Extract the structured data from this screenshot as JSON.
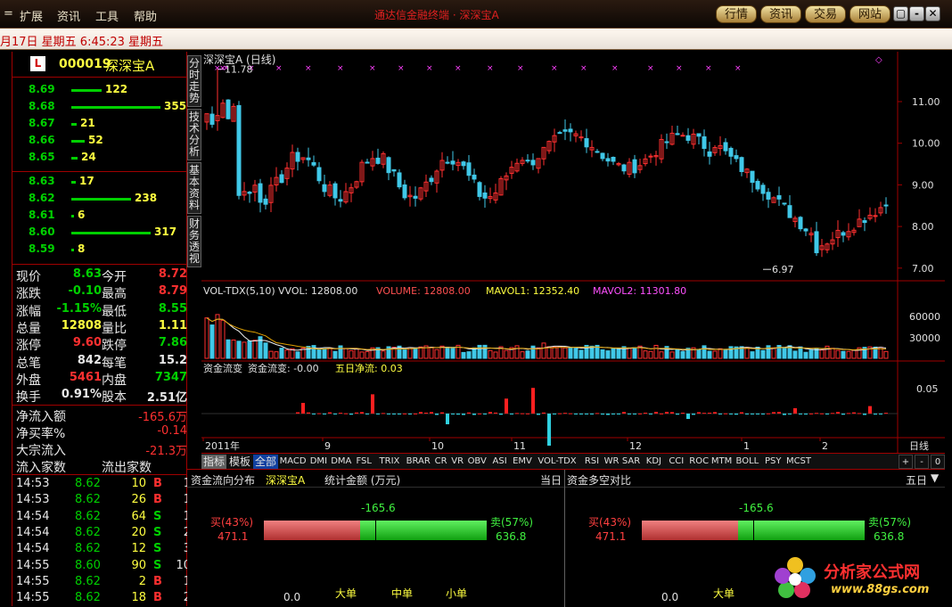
{
  "menu": {
    "items": [
      "扩展",
      "资讯",
      "工具",
      "帮助"
    ],
    "title": "通达信金融终端 · 深深宝A"
  },
  "top_buttons": [
    "行情",
    "资讯",
    "交易",
    "网站"
  ],
  "window_controls": [
    "▢",
    "-",
    "□",
    "✕"
  ],
  "status": {
    "datetime": "月17日  星期五  6:45:23 星期五"
  },
  "stock": {
    "badge": "L",
    "code": "000019",
    "name": "深深宝A"
  },
  "orderbook": {
    "asks": [
      {
        "price": "8.69",
        "vol": "122",
        "len": 0.34
      },
      {
        "price": "8.68",
        "vol": "355",
        "len": 1.0
      },
      {
        "price": "8.67",
        "vol": "21",
        "len": 0.06
      },
      {
        "price": "8.66",
        "vol": "52",
        "len": 0.15
      },
      {
        "price": "8.65",
        "vol": "24",
        "len": 0.07
      }
    ],
    "bids": [
      {
        "price": "8.63",
        "vol": "17",
        "len": 0.05
      },
      {
        "price": "8.62",
        "vol": "238",
        "len": 0.67
      },
      {
        "price": "8.61",
        "vol": "6",
        "len": 0.02
      },
      {
        "price": "8.60",
        "vol": "317",
        "len": 0.89
      },
      {
        "price": "8.59",
        "vol": "8",
        "len": 0.02
      }
    ]
  },
  "quote": [
    {
      "l1": "现价",
      "v1": "8.63",
      "c1": "#00d000",
      "l2": "今开",
      "v2": "8.72",
      "c2": "#ff3030"
    },
    {
      "l1": "涨跌",
      "v1": "-0.10",
      "c1": "#00d000",
      "l2": "最高",
      "v2": "8.79",
      "c2": "#ff3030"
    },
    {
      "l1": "涨幅",
      "v1": "-1.15%",
      "c1": "#00d000",
      "l2": "最低",
      "v2": "8.55",
      "c2": "#00d000"
    },
    {
      "l1": "总量",
      "v1": "12808",
      "c1": "#ffff40",
      "l2": "量比",
      "v2": "1.11",
      "c2": "#ffff40"
    },
    {
      "l1": "涨停",
      "v1": "9.60",
      "c1": "#ff3030",
      "l2": "跌停",
      "v2": "7.86",
      "c2": "#00d000"
    },
    {
      "l1": "总笔",
      "v1": "842",
      "c1": "#e8e8e8",
      "l2": "每笔",
      "v2": "15.2",
      "c2": "#e8e8e8"
    },
    {
      "l1": "外盘",
      "v1": "5461",
      "c1": "#ff3030",
      "l2": "内盘",
      "v2": "7347",
      "c2": "#00d000"
    },
    {
      "l1": "换手",
      "v1": "0.91%",
      "c1": "#e8e8e8",
      "l2": "股本",
      "v2": "2.51亿",
      "c2": "#e8e8e8"
    }
  ],
  "flow": [
    {
      "label": "净流入额",
      "value": "-165.6万",
      "color": "#ff3030"
    },
    {
      "label": "净买率%",
      "value": "-0.14",
      "color": "#ff3030"
    },
    {
      "label": "大宗流入",
      "value": "-21.3万",
      "color": "#ff3030"
    },
    {
      "label": "流入家数",
      "value": "流出家数",
      "color": "#e8e8e8"
    }
  ],
  "ticks": [
    {
      "time": "14:53",
      "price": "8.62",
      "vol": "10",
      "bs": "B",
      "n": "1"
    },
    {
      "time": "14:53",
      "price": "8.62",
      "vol": "26",
      "bs": "B",
      "n": "1"
    },
    {
      "time": "14:54",
      "price": "8.62",
      "vol": "64",
      "bs": "S",
      "n": "1"
    },
    {
      "time": "14:54",
      "price": "8.62",
      "vol": "20",
      "bs": "S",
      "n": "2"
    },
    {
      "time": "14:54",
      "price": "8.62",
      "vol": "12",
      "bs": "S",
      "n": "3"
    },
    {
      "time": "14:55",
      "price": "8.60",
      "vol": "90",
      "bs": "S",
      "n": "10"
    },
    {
      "time": "14:55",
      "price": "8.62",
      "vol": "2",
      "bs": "B",
      "n": "1"
    },
    {
      "time": "14:55",
      "price": "8.62",
      "vol": "18",
      "bs": "B",
      "n": "2"
    }
  ],
  "vtabs": [
    "分时走势",
    "技术分析",
    "基本资料",
    "财务透视"
  ],
  "main_chart": {
    "title": "深深宝A (日线)",
    "high_label": "11.78",
    "low_label": "6.97",
    "y_ticks": [
      "11.00",
      "10.00",
      "9.00",
      "8.00",
      "7.00"
    ]
  },
  "vol_chart": {
    "header": [
      "VOL-TDX(5,10)",
      "VVOL: 12808.00",
      "VOLUME: 12808.00",
      "MAVOL1: 12352.40",
      "MAVOL2: 11301.80"
    ],
    "y_ticks": [
      "60000",
      "30000"
    ]
  },
  "flow_chart": {
    "header": [
      "资金流变",
      "资金流变: -0.00",
      "五日净流: 0.03"
    ],
    "y_ticks": [
      "0.05"
    ]
  },
  "x_labels": [
    "2011年",
    "9",
    "10",
    "11",
    "12",
    "1",
    "2"
  ],
  "x_right_label": "日线",
  "indicator_tabs": [
    "指标",
    "模板",
    "全部",
    "MACD",
    "DMI",
    "DMA",
    "FSL",
    "TRIX",
    "BRAR",
    "CR",
    "VR",
    "OBV",
    "ASI",
    "EMV",
    "VOL-TDX",
    "RSI",
    "WR",
    "SAR",
    "KDJ",
    "CCI",
    "ROC",
    "MTM",
    "BOLL",
    "PSY",
    "MCST"
  ],
  "indicator_controls": [
    "+",
    "-",
    "0"
  ],
  "fund_panel": {
    "left_title": "资金流向分布",
    "stock_name": "深深宝A",
    "unit_label": "统计金额 (万元)",
    "period_left": "当日",
    "right_title": "资金多空对比",
    "period_right": "五日",
    "buy_label": "买(43%)",
    "buy_value": "471.1",
    "sell_label": "卖(57%)",
    "sell_value": "636.8",
    "net": "-165.6",
    "axis_zero": "0.0",
    "categories": [
      "大单",
      "中单",
      "小单"
    ],
    "buy_ratio": 0.43
  },
  "watermark": {
    "text": "分析家公式网",
    "url": "www.88gs.com"
  }
}
